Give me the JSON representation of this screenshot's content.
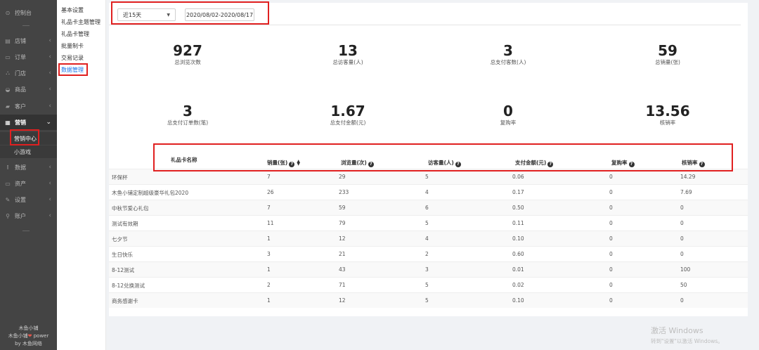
{
  "nav": {
    "items": [
      {
        "label": "控制台",
        "icon": "dashboard-icon",
        "glyph": "⊙",
        "chevron": ""
      },
      {
        "label": "店铺",
        "icon": "store-icon",
        "glyph": "▤",
        "chevron": "‹"
      },
      {
        "label": "订单",
        "icon": "order-icon",
        "glyph": "▭",
        "chevron": "‹"
      },
      {
        "label": "门店",
        "icon": "branch-icon",
        "glyph": "⛬",
        "chevron": "‹"
      },
      {
        "label": "商品",
        "icon": "goods-icon",
        "glyph": "◒",
        "chevron": "‹"
      },
      {
        "label": "客户",
        "icon": "customer-icon",
        "glyph": "▰",
        "chevron": "‹"
      },
      {
        "label": "营销",
        "icon": "marketing-icon",
        "glyph": "▦",
        "chevron": "⌄"
      },
      {
        "label": "数据",
        "icon": "data-icon",
        "glyph": "⫾",
        "chevron": "‹"
      },
      {
        "label": "资产",
        "icon": "asset-icon",
        "glyph": "▭",
        "chevron": "‹"
      },
      {
        "label": "设置",
        "icon": "settings-icon",
        "glyph": "✎",
        "chevron": "‹"
      },
      {
        "label": "账户",
        "icon": "account-icon",
        "glyph": "⚲",
        "chevron": "‹"
      }
    ],
    "sub_items": [
      "营销中心",
      "小游戏"
    ],
    "footer": {
      "line1": "木鱼小铺",
      "line2": "木鱼小铺",
      "power": "power",
      "line3": "by 木鱼网络"
    }
  },
  "submenu": [
    "基本设置",
    "礼品卡主题管理",
    "礼品卡管理",
    "批量制卡",
    "交易记录",
    "数据管理"
  ],
  "filter": {
    "range": "近15天",
    "dates": "2020/08/02-2020/08/17"
  },
  "stats": [
    {
      "value": "927",
      "label": "总浏览次数"
    },
    {
      "value": "13",
      "label": "总访客量(人)"
    },
    {
      "value": "3",
      "label": "总支付客数(人)"
    },
    {
      "value": "59",
      "label": "总销量(张)"
    },
    {
      "value": "3",
      "label": "总支付订单数(笔)"
    },
    {
      "value": "1.67",
      "label": "总支付金额(元)"
    },
    {
      "value": "0",
      "label": "复购率"
    },
    {
      "value": "13.56",
      "label": "核销率"
    }
  ],
  "table": {
    "headers": [
      "礼品卡名称",
      "销量(张)",
      "浏览量(次)",
      "访客量(人)",
      "支付金额(元)",
      "复购率",
      "核销率"
    ],
    "rows": [
      [
        "环保杯",
        "7",
        "29",
        "5",
        "0.06",
        "0",
        "14.29"
      ],
      [
        "木鱼小铺定制超级豪华礼包2020",
        "26",
        "233",
        "4",
        "0.17",
        "0",
        "7.69"
      ],
      [
        "中秋节爱心礼包",
        "7",
        "59",
        "6",
        "0.50",
        "0",
        "0"
      ],
      [
        "测试有效期",
        "11",
        "79",
        "5",
        "0.11",
        "0",
        "0"
      ],
      [
        "七夕节",
        "1",
        "12",
        "4",
        "0.10",
        "0",
        "0"
      ],
      [
        "生日快乐",
        "3",
        "21",
        "2",
        "0.60",
        "0",
        "0"
      ],
      [
        "8-12测试",
        "1",
        "43",
        "3",
        "0.01",
        "0",
        "100"
      ],
      [
        "8-12兑换测试",
        "2",
        "71",
        "5",
        "0.02",
        "0",
        "50"
      ],
      [
        "商务感谢卡",
        "1",
        "12",
        "5",
        "0.10",
        "0",
        "0"
      ]
    ]
  },
  "watermark": {
    "line1": "激活 Windows",
    "line2": "转到\"设置\"以激活 Windows。"
  }
}
